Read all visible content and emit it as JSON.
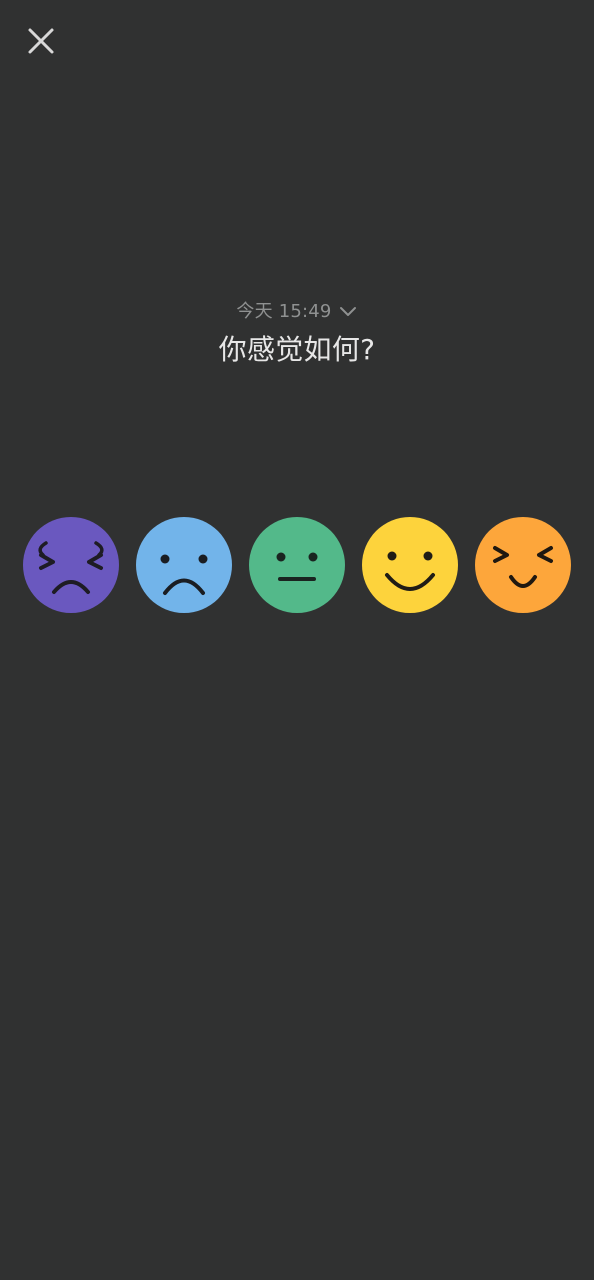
{
  "header": {
    "date_label": "今天 15:49",
    "question": "你感觉如何?"
  },
  "icons": {
    "close": "close-icon",
    "dropdown": "chevron-down-icon"
  },
  "moods": [
    {
      "id": "awful",
      "icon": "awful-face-icon",
      "color": "#6a58bf"
    },
    {
      "id": "bad",
      "icon": "sad-face-icon",
      "color": "#72b4ea"
    },
    {
      "id": "meh",
      "icon": "neutral-face-icon",
      "color": "#53b98a"
    },
    {
      "id": "good",
      "icon": "smile-face-icon",
      "color": "#fdd33c"
    },
    {
      "id": "great",
      "icon": "joyful-face-icon",
      "color": "#fda63b"
    }
  ],
  "colors": {
    "background": "#303131",
    "muted_text": "#8f9191",
    "primary_text": "#e7e7e7"
  }
}
